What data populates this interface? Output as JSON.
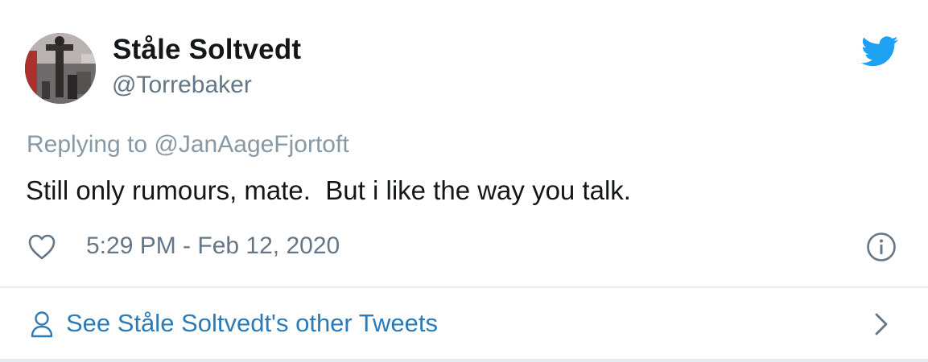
{
  "user": {
    "display_name": "Ståle Soltvedt",
    "handle": "@Torrebaker",
    "avatar": "profile-photo"
  },
  "tweet": {
    "reply_to": "Replying to @JanAageFjortoft",
    "text": "Still only rumours, mate.  But i like the way you talk.",
    "timestamp": "5:29 PM - Feb 12, 2020"
  },
  "footer": {
    "link_text": "See Ståle Soltvedt's other Tweets"
  },
  "icons": {
    "brand": "twitter-bird-icon",
    "like": "heart-icon",
    "info": "info-icon",
    "profile": "person-icon",
    "chevron": "chevron-right-icon"
  },
  "colors": {
    "brand_blue": "#1da1f2",
    "link_blue": "#2b7bb9",
    "text_primary": "#14171a",
    "text_secondary": "#657786",
    "divider": "#e6ecf0"
  }
}
